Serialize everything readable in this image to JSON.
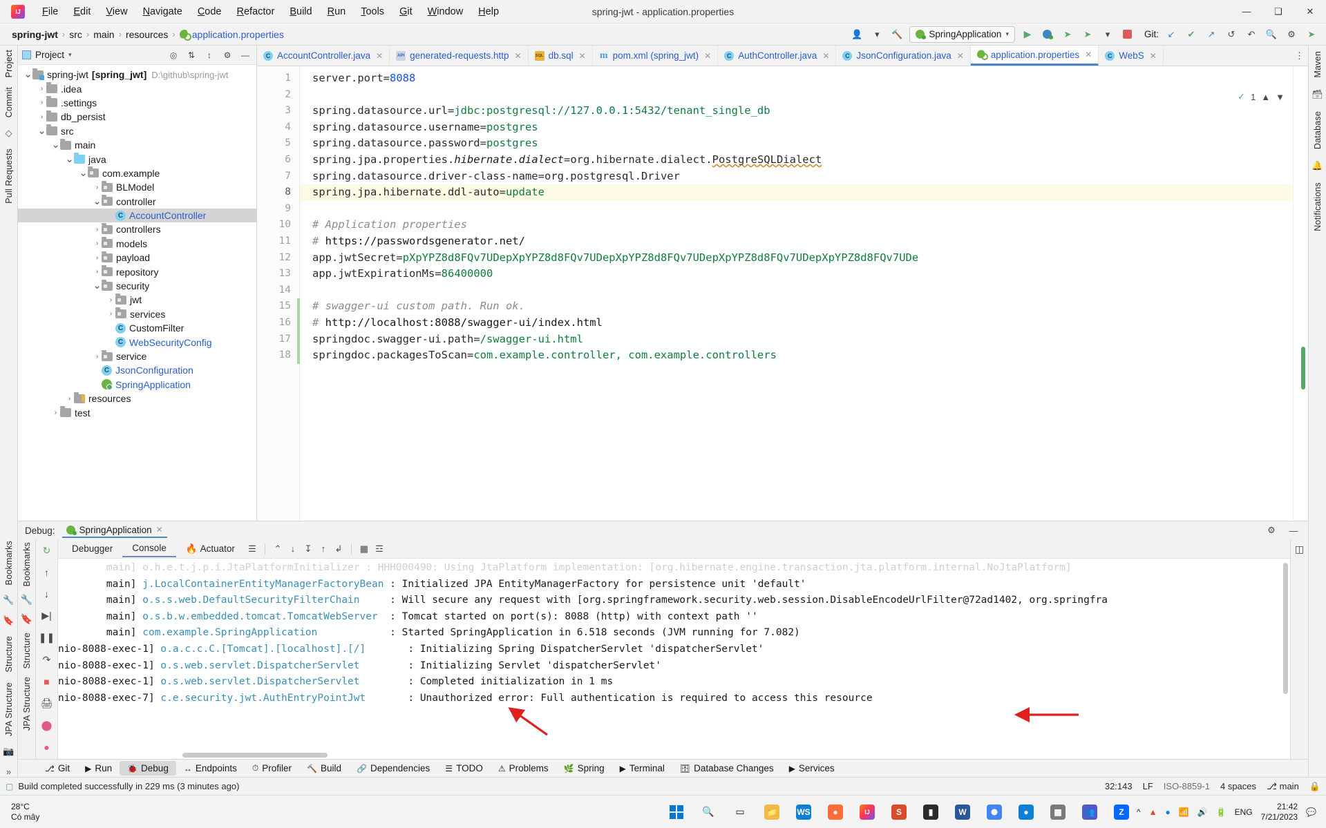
{
  "titlebar": {
    "title": "spring-jwt - application.properties",
    "menus": [
      "File",
      "Edit",
      "View",
      "Navigate",
      "Code",
      "Refactor",
      "Build",
      "Run",
      "Tools",
      "Git",
      "Window",
      "Help"
    ],
    "minimize": "—",
    "maximize": "❑",
    "close": "✕"
  },
  "navbar": {
    "crumbs": [
      "spring-jwt",
      "src",
      "main",
      "resources",
      "application.properties"
    ],
    "separator": "›",
    "run_config": "SpringApplication",
    "git_label": "Git:",
    "icons": {
      "profile": "👤",
      "hammer": "🔨",
      "run": "▶",
      "debug": "🐞",
      "coverage": "↻",
      "stop": "■",
      "update": "↙",
      "commit": "✔",
      "push": "↗",
      "history": "↺",
      "rollback": "↶",
      "search": "🔍",
      "settings": "⚙",
      "search_everywhere": "➤"
    }
  },
  "left_strip": {
    "items": [
      "Project",
      "Commit",
      "Pull Requests"
    ]
  },
  "right_strip": {
    "items": [
      "Maven",
      "Database",
      "Notifications"
    ]
  },
  "project_panel": {
    "title": "Project",
    "tree": [
      {
        "depth": 0,
        "arrow": "down",
        "icon": "proj",
        "label": "spring-jwt",
        "bold_suffix": "[spring_jwt]",
        "path": "D:\\github\\spring-jwt",
        "selected": false
      },
      {
        "depth": 1,
        "arrow": "right",
        "icon": "folder",
        "label": ".idea",
        "selected": false
      },
      {
        "depth": 1,
        "arrow": "right",
        "icon": "folder",
        "label": ".settings",
        "selected": false
      },
      {
        "depth": 1,
        "arrow": "right",
        "icon": "folder",
        "label": "db_persist",
        "selected": false
      },
      {
        "depth": 1,
        "arrow": "down",
        "icon": "folder",
        "label": "src",
        "selected": false
      },
      {
        "depth": 2,
        "arrow": "down",
        "icon": "folder",
        "label": "main",
        "selected": false
      },
      {
        "depth": 3,
        "arrow": "down",
        "icon": "src",
        "label": "java",
        "selected": false
      },
      {
        "depth": 4,
        "arrow": "down",
        "icon": "pkg",
        "label": "com.example",
        "selected": false
      },
      {
        "depth": 5,
        "arrow": "right",
        "icon": "pkg",
        "label": "BLModel",
        "selected": false
      },
      {
        "depth": 5,
        "arrow": "down",
        "icon": "pkg",
        "label": "controller",
        "selected": false
      },
      {
        "depth": 6,
        "arrow": "none",
        "icon": "class",
        "label": "AccountController",
        "link": true,
        "selected": true
      },
      {
        "depth": 5,
        "arrow": "right",
        "icon": "pkg",
        "label": "controllers",
        "selected": false
      },
      {
        "depth": 5,
        "arrow": "right",
        "icon": "pkg",
        "label": "models",
        "selected": false
      },
      {
        "depth": 5,
        "arrow": "right",
        "icon": "pkg",
        "label": "payload",
        "selected": false
      },
      {
        "depth": 5,
        "arrow": "right",
        "icon": "pkg",
        "label": "repository",
        "selected": false
      },
      {
        "depth": 5,
        "arrow": "down",
        "icon": "pkg",
        "label": "security",
        "selected": false
      },
      {
        "depth": 6,
        "arrow": "right",
        "icon": "pkg",
        "label": "jwt",
        "selected": false
      },
      {
        "depth": 6,
        "arrow": "right",
        "icon": "pkg",
        "label": "services",
        "selected": false
      },
      {
        "depth": 6,
        "arrow": "none",
        "icon": "class",
        "label": "CustomFilter",
        "selected": false
      },
      {
        "depth": 6,
        "arrow": "none",
        "icon": "class",
        "label": "WebSecurityConfig",
        "link": true,
        "selected": false
      },
      {
        "depth": 5,
        "arrow": "right",
        "icon": "pkg",
        "label": "service",
        "selected": false
      },
      {
        "depth": 5,
        "arrow": "none",
        "icon": "class",
        "label": "JsonConfiguration",
        "link": true,
        "selected": false
      },
      {
        "depth": 5,
        "arrow": "none",
        "icon": "spring",
        "label": "SpringApplication",
        "link": true,
        "selected": false
      },
      {
        "depth": 3,
        "arrow": "right",
        "icon": "res",
        "label": "resources",
        "selected": false
      },
      {
        "depth": 2,
        "arrow": "right",
        "icon": "folder",
        "label": "test",
        "selected": false
      }
    ]
  },
  "editor": {
    "tabs": [
      {
        "label": "AccountController.java",
        "icon": "java",
        "active": false,
        "closable": true
      },
      {
        "label": "generated-requests.http",
        "icon": "http",
        "active": false,
        "closable": true
      },
      {
        "label": "db.sql",
        "icon": "sql",
        "active": false,
        "closable": true
      },
      {
        "label": "pom.xml (spring_jwt)",
        "icon": "xml",
        "active": false,
        "closable": true
      },
      {
        "label": "AuthController.java",
        "icon": "java",
        "active": false,
        "closable": true
      },
      {
        "label": "JsonConfiguration.java",
        "icon": "java",
        "active": false,
        "closable": true
      },
      {
        "label": "application.properties",
        "icon": "props",
        "active": true,
        "closable": true
      },
      {
        "label": "WebS",
        "icon": "java",
        "active": false,
        "closable": true
      }
    ],
    "inspection_count": "1",
    "lines": [
      {
        "n": 1,
        "highlight": false,
        "changed": false,
        "parts": [
          {
            "t": "server.port",
            "c": "k"
          },
          {
            "t": "=",
            "c": "eq"
          },
          {
            "t": "8088",
            "c": "num"
          }
        ]
      },
      {
        "n": 2,
        "highlight": false,
        "changed": false,
        "parts": []
      },
      {
        "n": 3,
        "highlight": false,
        "changed": false,
        "parts": [
          {
            "t": "spring.datasource.url",
            "c": "k"
          },
          {
            "t": "=",
            "c": "eq"
          },
          {
            "t": "jdbc:postgresql://127.0.0.1:5432/tenant_single_db",
            "c": "v"
          }
        ]
      },
      {
        "n": 4,
        "highlight": false,
        "changed": false,
        "parts": [
          {
            "t": "spring.datasource.username",
            "c": "k"
          },
          {
            "t": "=",
            "c": "eq"
          },
          {
            "t": "postgres",
            "c": "v"
          }
        ]
      },
      {
        "n": 5,
        "highlight": false,
        "changed": false,
        "parts": [
          {
            "t": "spring.datasource.password",
            "c": "k"
          },
          {
            "t": "=",
            "c": "eq"
          },
          {
            "t": "postgres",
            "c": "v"
          }
        ]
      },
      {
        "n": 6,
        "highlight": false,
        "changed": false,
        "parts": [
          {
            "t": "spring.jpa.properties.",
            "c": "k"
          },
          {
            "t": "hibernate",
            "c": "it"
          },
          {
            "t": ".",
            "c": "k"
          },
          {
            "t": "dialect",
            "c": "it"
          },
          {
            "t": "=",
            "c": "eq"
          },
          {
            "t": "org.hibernate.dialect.",
            "c": "k"
          },
          {
            "t": "PostgreSQLDialect",
            "c": "sq"
          }
        ]
      },
      {
        "n": 7,
        "highlight": false,
        "changed": false,
        "parts": [
          {
            "t": "spring.datasource.driver-class-name",
            "c": "k"
          },
          {
            "t": "=",
            "c": "eq"
          },
          {
            "t": "org.postgresql.Driver",
            "c": "k"
          }
        ]
      },
      {
        "n": 8,
        "highlight": true,
        "changed": false,
        "parts": [
          {
            "t": "spring.jpa.hibernate.ddl-auto",
            "c": "k"
          },
          {
            "t": "=",
            "c": "eq"
          },
          {
            "t": "update",
            "c": "v"
          }
        ]
      },
      {
        "n": 9,
        "highlight": false,
        "changed": false,
        "parts": []
      },
      {
        "n": 10,
        "highlight": false,
        "changed": false,
        "parts": [
          {
            "t": "# Application properties",
            "c": "cmt"
          }
        ]
      },
      {
        "n": 11,
        "highlight": false,
        "changed": false,
        "parts": [
          {
            "t": "# ",
            "c": "cmt"
          },
          {
            "t": "https://passwordsgenerator.net/",
            "c": "url"
          }
        ]
      },
      {
        "n": 12,
        "highlight": false,
        "changed": false,
        "parts": [
          {
            "t": "app.jwtSecret",
            "c": "k"
          },
          {
            "t": "=",
            "c": "eq"
          },
          {
            "t": "pXpYPZ8d8FQv7UDepXpYPZ8d8FQv7UDepXpYPZ8d8FQv7UDepXpYPZ8d8FQv7UDepXpYPZ8d8FQv7UDe",
            "c": "v"
          }
        ]
      },
      {
        "n": 13,
        "highlight": false,
        "changed": false,
        "parts": [
          {
            "t": "app.jwtExpirationMs",
            "c": "k"
          },
          {
            "t": "=",
            "c": "eq"
          },
          {
            "t": "86400000",
            "c": "v"
          }
        ]
      },
      {
        "n": 14,
        "highlight": false,
        "changed": false,
        "parts": []
      },
      {
        "n": 15,
        "highlight": false,
        "changed": true,
        "parts": [
          {
            "t": "# swagger-ui custom path. Run ok.",
            "c": "cmt"
          }
        ]
      },
      {
        "n": 16,
        "highlight": false,
        "changed": true,
        "parts": [
          {
            "t": "# ",
            "c": "cmt"
          },
          {
            "t": "http://localhost:8088/swagger-ui/index.html",
            "c": "url"
          }
        ]
      },
      {
        "n": 17,
        "highlight": false,
        "changed": true,
        "parts": [
          {
            "t": "springdoc.swagger-ui.path",
            "c": "k"
          },
          {
            "t": "=",
            "c": "eq"
          },
          {
            "t": "/swagger-ui.html",
            "c": "v"
          }
        ]
      },
      {
        "n": 18,
        "highlight": false,
        "changed": true,
        "parts": [
          {
            "t": "springdoc.packagesToScan",
            "c": "k"
          },
          {
            "t": "=",
            "c": "eq"
          },
          {
            "t": "com.example.controller, com.example.controllers",
            "c": "v"
          }
        ]
      }
    ]
  },
  "debug": {
    "label": "Debug:",
    "session_tab": "SpringApplication",
    "close": "✕",
    "settings_icon": "⚙",
    "minimize_icon": "—",
    "console_tabs": [
      {
        "label": "Debugger",
        "active": false
      },
      {
        "label": "Console",
        "active": true
      },
      {
        "label": "Actuator",
        "active": false,
        "icon": "flame"
      }
    ],
    "log": [
      {
        "thread": "        main]",
        "cls": "o.h.e.t.j.p.i.JtaPlatformInitializer",
        "sep": " : ",
        "msg": "HHH000490: Using JtaPlatform implementation: [org.hibernate.engine.transaction.jta.platform.internal.NoJtaPlatform]",
        "faded": true
      },
      {
        "thread": "        main]",
        "cls": "j.LocalContainerEntityManagerFactoryBean",
        "sep": " : ",
        "msg": "Initialized JPA EntityManagerFactory for persistence unit 'default'",
        "faded": false
      },
      {
        "thread": "        main]",
        "cls": "o.s.s.web.DefaultSecurityFilterChain",
        "sep": "     : ",
        "msg": "Will secure any request with [org.springframework.security.web.session.DisableEncodeUrlFilter@72ad1402, org.springfra",
        "faded": false
      },
      {
        "thread": "        main]",
        "cls": "o.s.b.w.embedded.tomcat.TomcatWebServer",
        "sep": "  : ",
        "msg": "Tomcat started on port(s): 8088 (http) with context path ''",
        "faded": false
      },
      {
        "thread": "        main]",
        "cls": "com.example.SpringApplication",
        "sep": "            : ",
        "msg": "Started SpringApplication in 6.518 seconds (JVM running for 7.082)",
        "faded": false
      },
      {
        "thread": "nio-8088-exec-1]",
        "cls": "o.a.c.c.C.[Tomcat].[localhost].[/]",
        "sep": "       : ",
        "msg": "Initializing Spring DispatcherServlet 'dispatcherServlet'",
        "faded": false
      },
      {
        "thread": "nio-8088-exec-1]",
        "cls": "o.s.web.servlet.DispatcherServlet",
        "sep": "        : ",
        "msg": "Initializing Servlet 'dispatcherServlet'",
        "faded": false
      },
      {
        "thread": "nio-8088-exec-1]",
        "cls": "o.s.web.servlet.DispatcherServlet",
        "sep": "        : ",
        "msg": "Completed initialization in 1 ms",
        "faded": false
      },
      {
        "thread": "nio-8088-exec-7]",
        "cls": "c.e.security.jwt.AuthEntryPointJwt",
        "sep": "       : ",
        "msg": "Unauthorized error: Full authentication is required to access this resource",
        "faded": false
      }
    ]
  },
  "bottom_tools": [
    {
      "label": "Git",
      "icon": "⎇",
      "active": false
    },
    {
      "label": "Run",
      "icon": "▶",
      "active": false
    },
    {
      "label": "Debug",
      "icon": "🐞",
      "active": true
    },
    {
      "label": "Endpoints",
      "icon": "↔",
      "active": false
    },
    {
      "label": "Profiler",
      "icon": "⏱",
      "active": false
    },
    {
      "label": "Build",
      "icon": "🔨",
      "active": false
    },
    {
      "label": "Dependencies",
      "icon": "🔗",
      "active": false
    },
    {
      "label": "TODO",
      "icon": "☰",
      "active": false
    },
    {
      "label": "Problems",
      "icon": "⚠",
      "active": false
    },
    {
      "label": "Spring",
      "icon": "🌿",
      "active": false
    },
    {
      "label": "Terminal",
      "icon": "▶",
      "active": false
    },
    {
      "label": "Database Changes",
      "icon": "🗄",
      "active": false
    },
    {
      "label": "Services",
      "icon": "▶",
      "active": false
    }
  ],
  "statusbar": {
    "build_message": "Build completed successfully in 229 ms (3 minutes ago)",
    "caret": "32:143",
    "line_sep": "LF",
    "encoding": "ISO-8859-1",
    "indent": "4 spaces",
    "branch": "main",
    "lock": "🔒"
  },
  "taskbar": {
    "weather_temp": "28°C",
    "weather_desc": "Có mây",
    "time": "21:42",
    "date": "7/21/2023",
    "lang": "ENG",
    "search_icon": "🔍",
    "taskview_icon": "▭"
  }
}
